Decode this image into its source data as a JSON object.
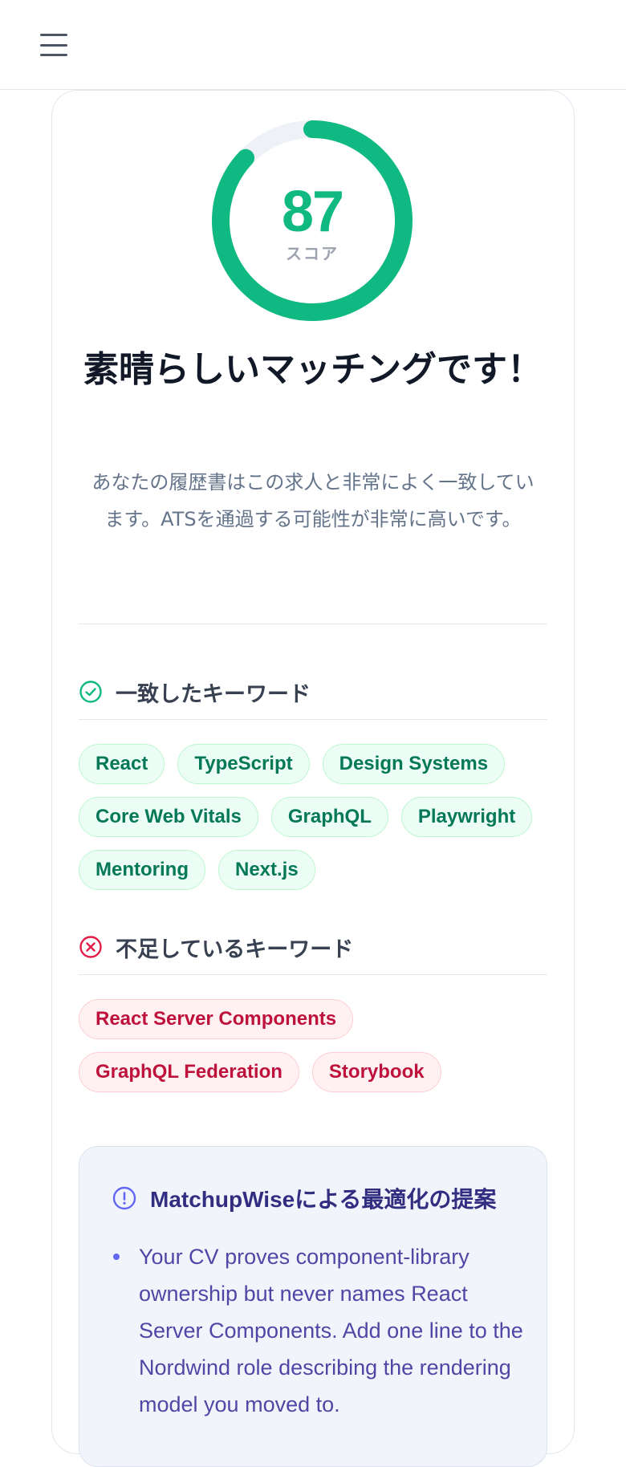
{
  "header": {
    "menu_icon": "hamburger-menu-icon"
  },
  "score": {
    "value": "87",
    "percent": 87,
    "label": "スコア",
    "color": "#10b981",
    "track_color": "#eef2f7"
  },
  "result": {
    "headline": "素晴らしいマッチングです！",
    "description": "あなたの履歴書はこの求人と非常によく一致しています。ATSを通過する可能性が非常に高いです。"
  },
  "matched": {
    "title": "一致したキーワード",
    "icon": "check-circle-icon",
    "keywords": [
      "React",
      "TypeScript",
      "Design Systems",
      "Core Web Vitals",
      "GraphQL",
      "Playwright",
      "Mentoring",
      "Next.js"
    ]
  },
  "missing": {
    "title": "不足しているキーワード",
    "icon": "x-circle-icon",
    "keywords": [
      "React Server Components",
      "GraphQL Federation",
      "Storybook"
    ]
  },
  "suggestions": {
    "title": "MatchupWiseによる最適化の提案",
    "icon": "alert-circle-icon",
    "items": [
      "Your CV proves component-library ownership but never names React Server Components. Add one line to the Nordwind role describing the rendering model you moved to."
    ]
  }
}
